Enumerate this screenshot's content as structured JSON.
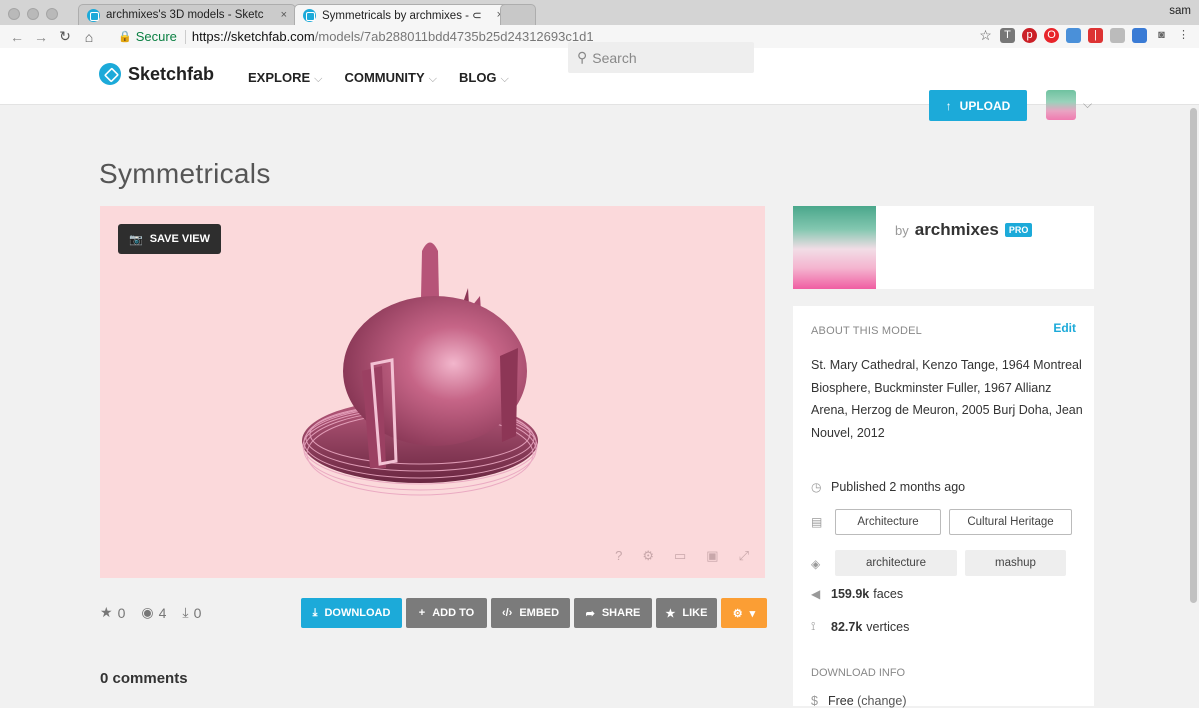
{
  "browser": {
    "user": "sam",
    "tabs": [
      {
        "title": "archmixes's 3D models - Sketc",
        "close": "×"
      },
      {
        "title": "Symmetricals by archmixes - ⊂",
        "close": "×"
      }
    ],
    "address": {
      "secure_label": "Secure",
      "host": "https://sketchfab.com",
      "path": "/models/7ab288011bdd4735b25d24312693c1d1"
    }
  },
  "header": {
    "logo_text": "Sketchfab",
    "nav": [
      {
        "label": "EXPLORE"
      },
      {
        "label": "COMMUNITY"
      },
      {
        "label": "BLOG"
      }
    ],
    "search_placeholder": "Search",
    "upload_label": "UPLOAD"
  },
  "model": {
    "title": "Symmetricals",
    "save_view_label": "SAVE VIEW",
    "stats": {
      "likes": "0",
      "views": "4",
      "downloads": "0"
    },
    "actions": {
      "download": "DOWNLOAD",
      "add_to": "ADD TO",
      "embed": "EMBED",
      "share": "SHARE",
      "like": "LIKE"
    },
    "comments_label": "0 comments"
  },
  "author": {
    "by": "by",
    "name": "archmixes",
    "badge": "PRO"
  },
  "about": {
    "heading": "ABOUT THIS MODEL",
    "edit": "Edit",
    "description": "St. Mary Cathedral, Kenzo Tange, 1964 Montreal Biosphere, Buckminster Fuller, 1967 Allianz Arena, Herzog de Meuron, 2005 Burj Doha, Jean Nouvel, 2012",
    "published": "Published 2 months ago",
    "categories": [
      "Architecture",
      "Cultural Heritage"
    ],
    "tags": [
      "architecture",
      "mashup"
    ],
    "faces_value": "159.9k",
    "faces_unit": "faces",
    "vertices_value": "82.7k",
    "vertices_unit": "vertices",
    "download_heading": "DOWNLOAD INFO",
    "price": "Free",
    "change": "(change)"
  }
}
